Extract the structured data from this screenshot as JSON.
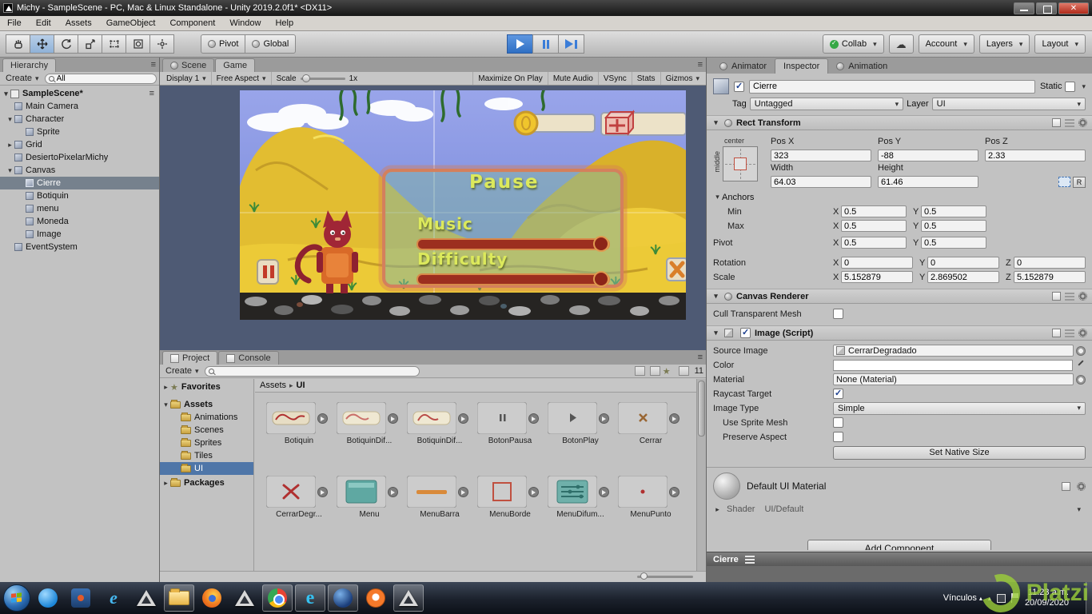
{
  "window": {
    "title": "Michy - SampleScene - PC, Mac & Linux Standalone - Unity 2019.2.0f1* <DX11>"
  },
  "menubar": {
    "items": [
      "File",
      "Edit",
      "Assets",
      "GameObject",
      "Component",
      "Window",
      "Help"
    ]
  },
  "toolbar": {
    "pivot": "Pivot",
    "global": "Global",
    "collab": "Collab",
    "account": "Account",
    "layers": "Layers",
    "layout": "Layout"
  },
  "hierarchy": {
    "tab": "Hierarchy",
    "create": "Create",
    "search": "All",
    "scene": "SampleScene*",
    "items": [
      "Main Camera",
      "Character",
      "Sprite",
      "Grid",
      "DesiertoPixelarMichy",
      "Canvas",
      "Cierre",
      "Botiquin",
      "menu",
      "Moneda",
      "Image",
      "EventSystem"
    ]
  },
  "game": {
    "tab_scene": "Scene",
    "tab_game": "Game",
    "display": "Display 1",
    "aspect": "Free Aspect",
    "scale_label": "Scale",
    "scale_value": "1x",
    "maximize": "Maximize On Play",
    "mute": "Mute Audio",
    "vsync": "VSync",
    "stats": "Stats",
    "gizmos": "Gizmos",
    "pause": "Pause",
    "music": "Music",
    "difficulty": "Difficulty"
  },
  "project": {
    "tab_project": "Project",
    "tab_console": "Console",
    "create": "Create",
    "favorites": "Favorites",
    "assets_folder": "Assets",
    "packages": "Packages",
    "folders": [
      "Animations",
      "Scenes",
      "Sprites",
      "Tiles",
      "UI"
    ],
    "breadcrumb_root": "Assets",
    "breadcrumb_current": "UI",
    "count": "11",
    "assets": [
      "Botiquin",
      "BotiquinDif...",
      "BotiquinDif...",
      "BotonPausa",
      "BotonPlay",
      "Cerrar",
      "CerrarDegr...",
      "Menu",
      "MenuBarra",
      "MenuBorde",
      "MenuDifum...",
      "MenuPunto"
    ]
  },
  "inspector": {
    "tab_animator": "Animator",
    "tab_inspector": "Inspector",
    "tab_animation": "Animation",
    "name": "Cierre",
    "static": "Static",
    "tag_label": "Tag",
    "tag": "Untagged",
    "layer_label": "Layer",
    "layer": "UI",
    "rect": {
      "title": "Rect Transform",
      "anchor_h": "center",
      "anchor_v": "middle",
      "posx_l": "Pos X",
      "posy_l": "Pos Y",
      "posz_l": "Pos Z",
      "posx": "323",
      "posy": "-88",
      "posz": "2.33",
      "width_l": "Width",
      "height_l": "Height",
      "width": "64.03",
      "height": "61.46",
      "r": "R",
      "anchors": "Anchors",
      "min_l": "Min",
      "max_l": "Max",
      "pivot_l": "Pivot",
      "rotation_l": "Rotation",
      "scale_l": "Scale",
      "x": "X",
      "y": "Y",
      "z": "Z",
      "min_x": "0.5",
      "min_y": "0.5",
      "max_x": "0.5",
      "max_y": "0.5",
      "pivot_x": "0.5",
      "pivot_y": "0.5",
      "rot_x": "0",
      "rot_y": "0",
      "rot_z": "0",
      "scale_x": "5.152879",
      "scale_y": "2.869502",
      "scale_z": "5.152879"
    },
    "canvas_renderer": {
      "title": "Canvas Renderer",
      "cull": "Cull Transparent Mesh"
    },
    "image": {
      "title": "Image (Script)",
      "source_l": "Source Image",
      "source": "CerrarDegradado",
      "color_l": "Color",
      "material_l": "Material",
      "material": "None (Material)",
      "raycast_l": "Raycast Target",
      "type_l": "Image Type",
      "type": "Simple",
      "mesh_l": "Use Sprite Mesh",
      "preserve_l": "Preserve Aspect",
      "native": "Set Native Size"
    },
    "material": {
      "title": "Default UI Material",
      "shader_l": "Shader",
      "shader": "UI/Default"
    },
    "add_component": "Add Component",
    "preview": "Cierre"
  },
  "taskbar": {
    "links": "Vínculos",
    "time": "11:23 a.m.",
    "date": "20/09/2020"
  },
  "watermark": "Platzi"
}
